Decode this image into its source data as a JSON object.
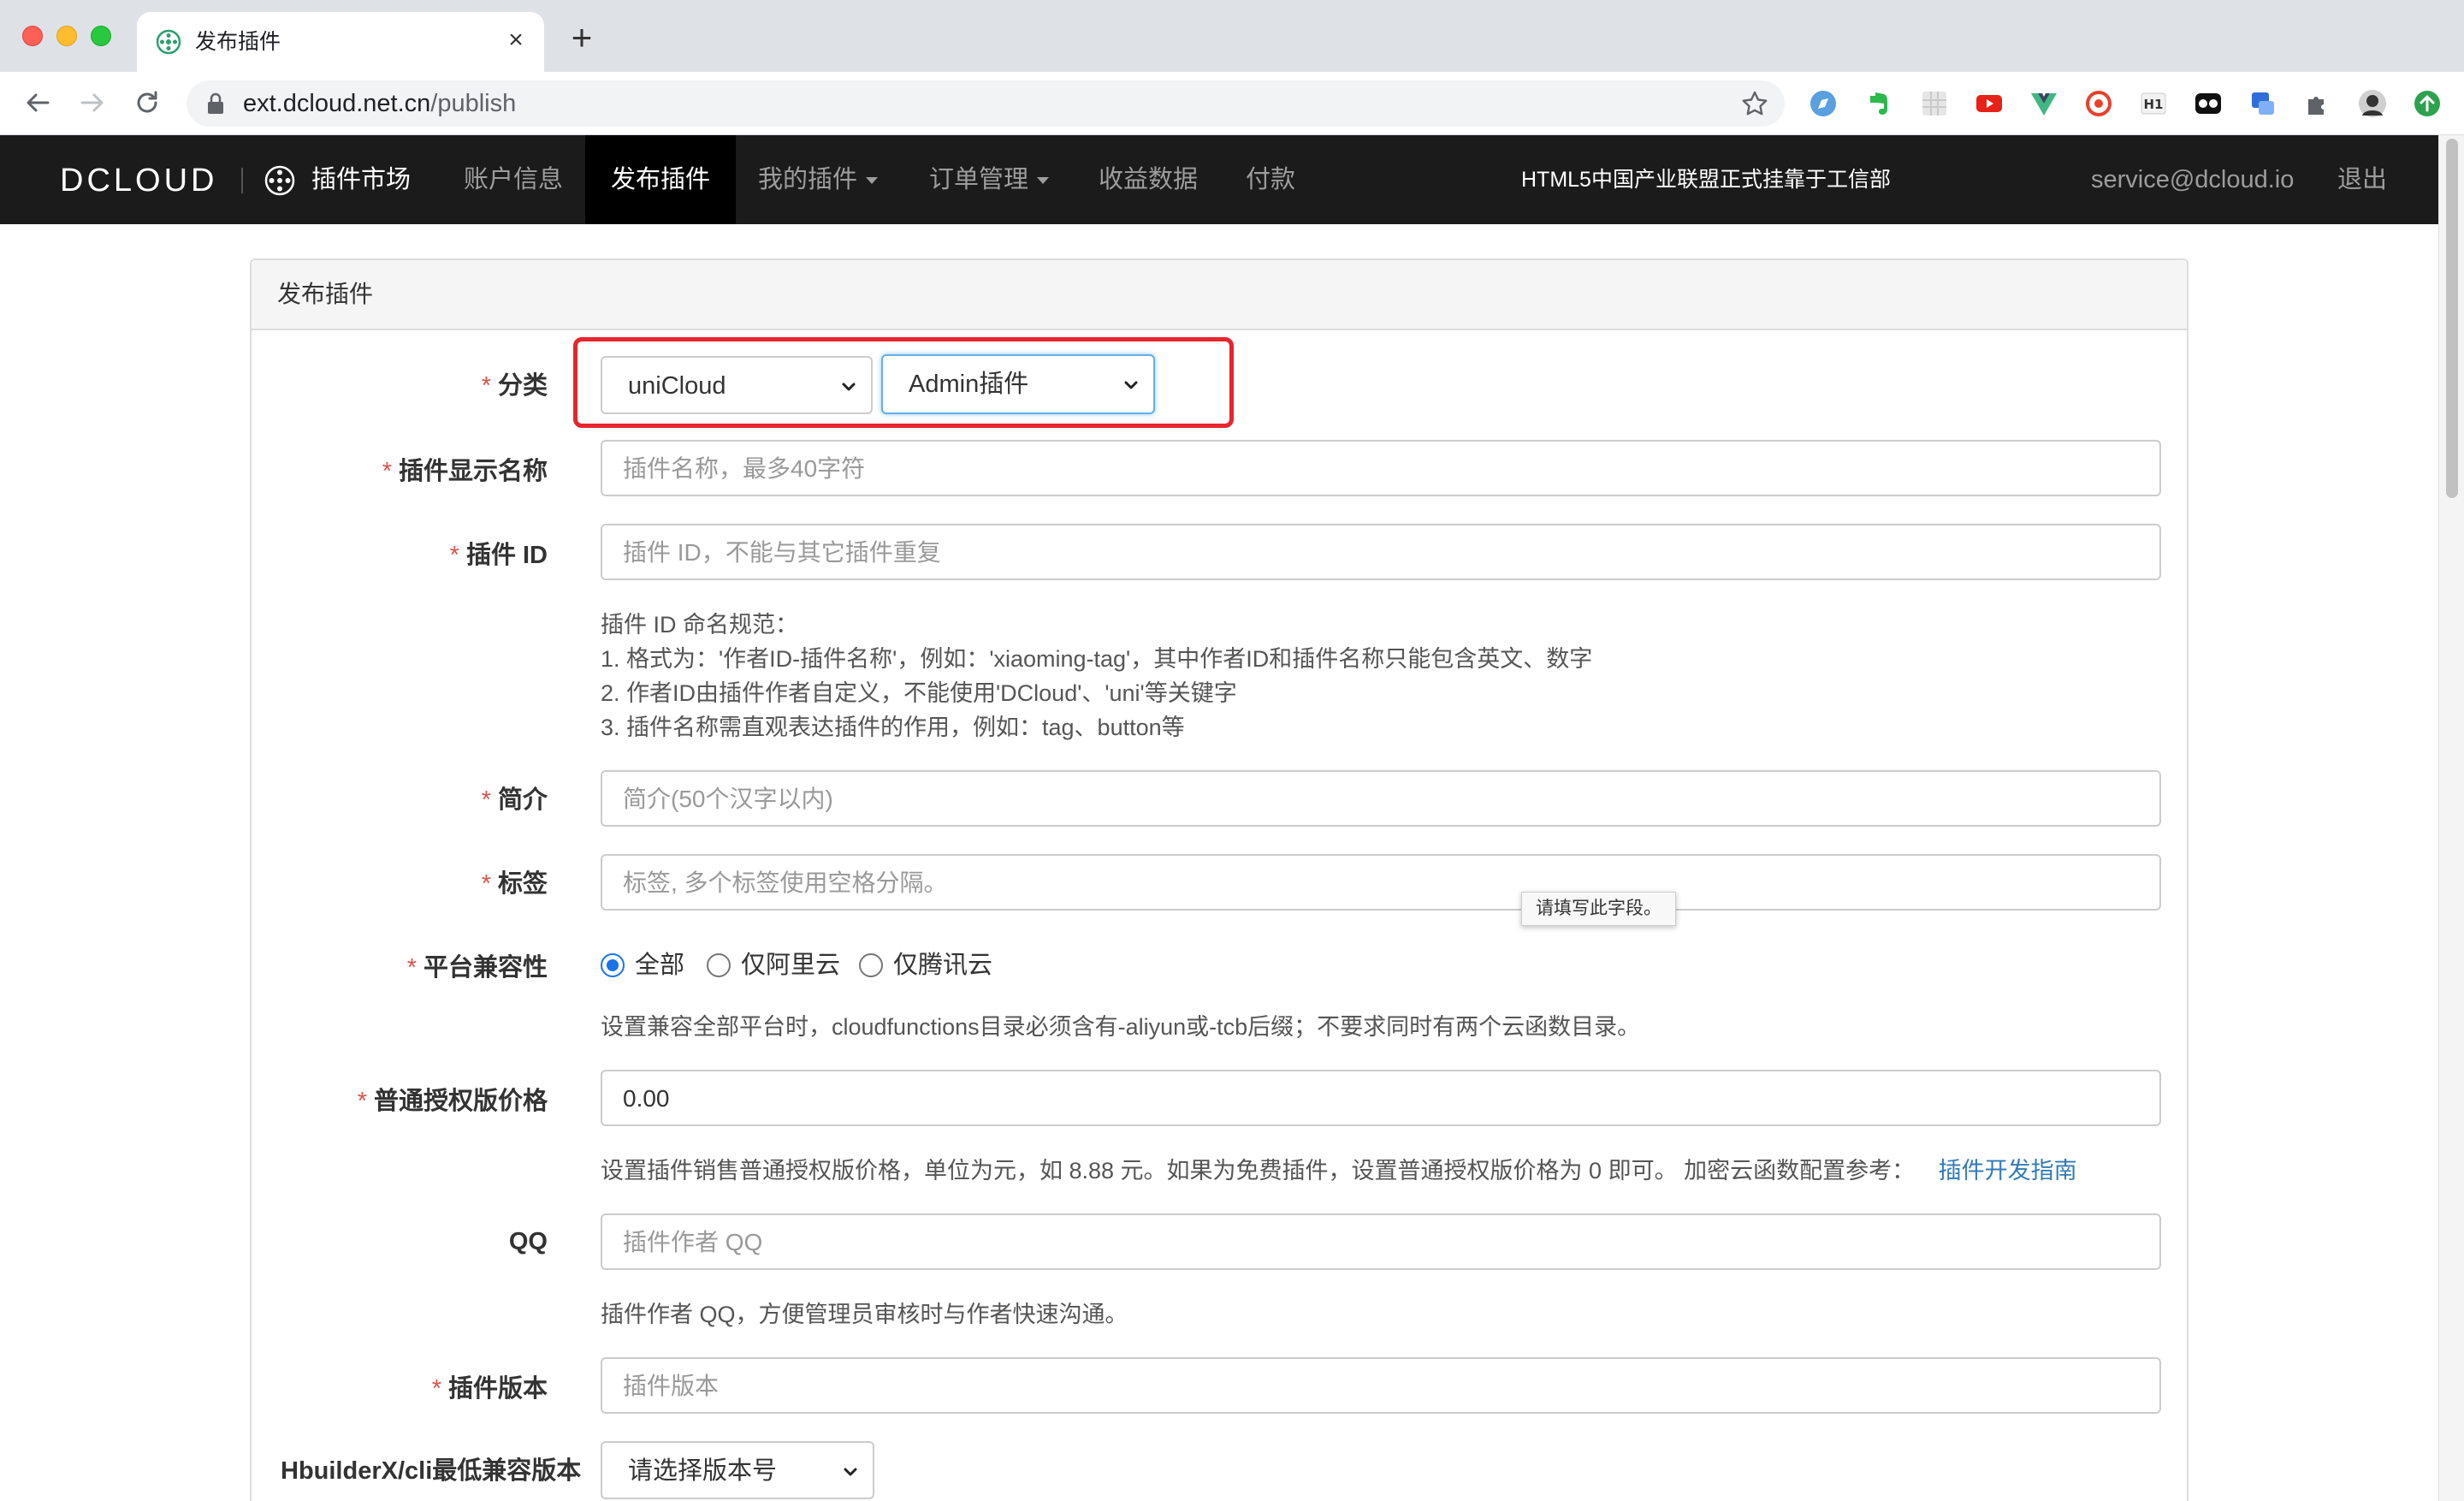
{
  "browser": {
    "tab_title": "发布插件",
    "url_host": "ext.dcloud.net.cn",
    "url_path": "/publish"
  },
  "nav": {
    "logo": "DCLOUD",
    "market": "插件市场",
    "items": [
      "账户信息",
      "发布插件",
      "我的插件",
      "订单管理",
      "收益数据",
      "付款"
    ],
    "center_text": "HTML5中国产业联盟正式挂靠于工信部",
    "email": "service@dcloud.io",
    "logout": "退出"
  },
  "panel": {
    "title": "发布插件"
  },
  "form": {
    "category": {
      "label": "分类",
      "primary_value": "uniCloud",
      "secondary_value": "Admin插件"
    },
    "display_name": {
      "label": "插件显示名称",
      "placeholder": "插件名称，最多40字符"
    },
    "plugin_id": {
      "label": "插件 ID",
      "placeholder": "插件 ID，不能与其它插件重复",
      "help": [
        "插件 ID 命名规范：",
        "1. 格式为：'作者ID-插件名称'，例如：'xiaoming-tag'，其中作者ID和插件名称只能包含英文、数字",
        "2. 作者ID由插件作者自定义，不能使用'DCloud'、'uni'等关键字",
        "3. 插件名称需直观表达插件的作用，例如：tag、button等"
      ]
    },
    "intro": {
      "label": "简介",
      "placeholder": "简介(50个汉字以内)"
    },
    "tags": {
      "label": "标签",
      "placeholder": "标签, 多个标签使用空格分隔。",
      "tooltip": "请填写此字段。"
    },
    "platform": {
      "label": "平台兼容性",
      "options": [
        "全部",
        "仅阿里云",
        "仅腾讯云"
      ],
      "selected": "全部",
      "help": "设置兼容全部平台时，cloudfunctions目录必须含有-aliyun或-tcb后缀；不要求同时有两个云函数目录。"
    },
    "price": {
      "label": "普通授权版价格",
      "value": "0.00",
      "help": "设置插件销售普通授权版价格，单位为元，如 8.88 元。如果为免费插件，设置普通授权版价格为 0 即可。 加密云函数配置参考：",
      "help_link": "插件开发指南"
    },
    "qq": {
      "label": "QQ",
      "placeholder": "插件作者 QQ",
      "help": "插件作者 QQ，方便管理员审核时与作者快速沟通。"
    },
    "version": {
      "label": "插件版本",
      "placeholder": "插件版本"
    },
    "hbuilder": {
      "label": "HbuilderX/cli最低兼容版本",
      "value": "请选择版本号"
    }
  },
  "colors": {
    "required": "#d9534f",
    "link": "#337ab7",
    "highlight": "#e8242e",
    "nav_bg": "#1b1b1b"
  }
}
